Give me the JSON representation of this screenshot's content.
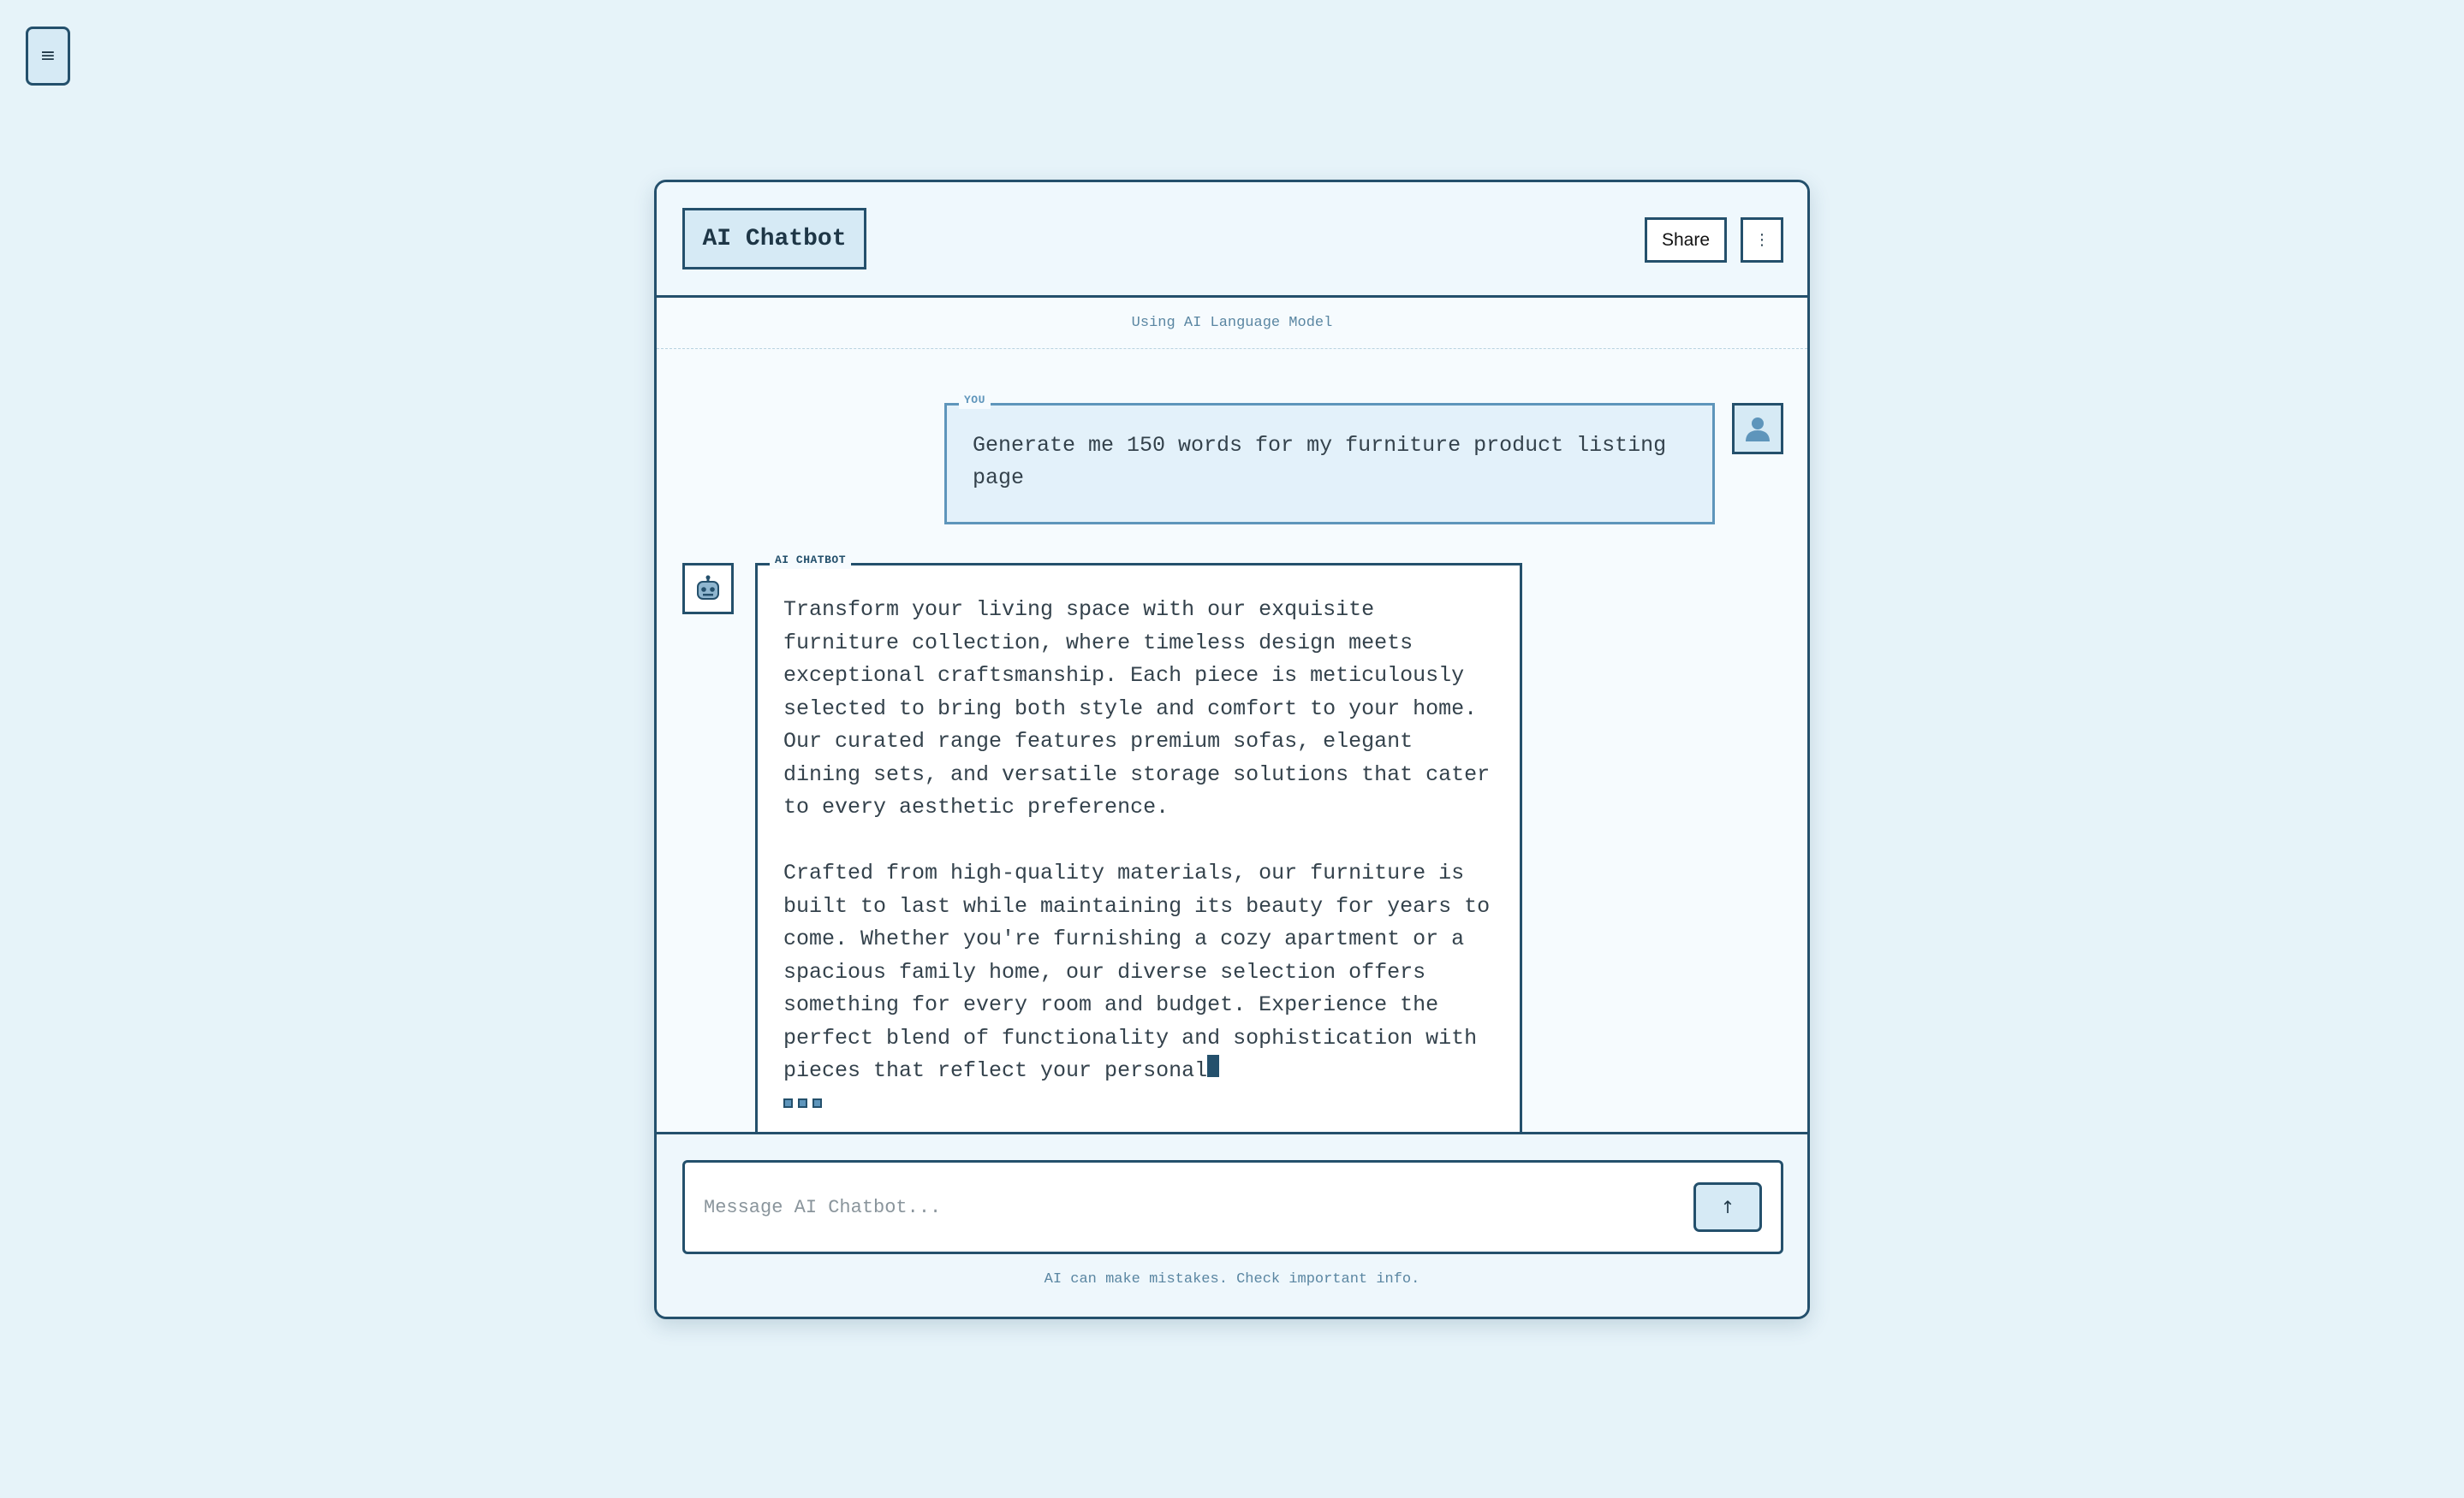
{
  "menu_button": {
    "icon": "≡"
  },
  "header": {
    "title": "AI Chatbot",
    "share_label": "Share",
    "more_icon": "⋮"
  },
  "model_info": "Using AI Language Model",
  "messages": [
    {
      "role_label": "YOU",
      "text": "Generate me 150 words for my furniture product listing page"
    },
    {
      "role_label": "AI CHATBOT",
      "paragraphs": [
        "Transform your living space with our exquisite furniture collection, where timeless design meets exceptional craftsmanship. Each piece is meticulously selected to bring both style and comfort to your home. Our curated range features premium sofas, elegant dining sets, and versatile storage solutions that cater to every aesthetic preference.",
        "Crafted from high-quality materials, our furniture is built to last while maintaining its beauty for years to come. Whether you're furnishing a cozy apartment or a spacious family home, our diverse selection offers something for every room and budget. Experience the perfect blend of functionality and sophistication with pieces that reflect your personal"
      ]
    }
  ],
  "composer": {
    "placeholder": "Message AI Chatbot...",
    "send_icon": "↑"
  },
  "disclaimer": "AI can make mistakes. Check important info.",
  "colors": {
    "page_background": "#e6f3f9",
    "border": "#24506c",
    "accent_fill": "#d6eaf5",
    "user_bubble": "#e3f1fa",
    "user_border": "#5e95bb",
    "muted_text": "#5a86a2"
  }
}
